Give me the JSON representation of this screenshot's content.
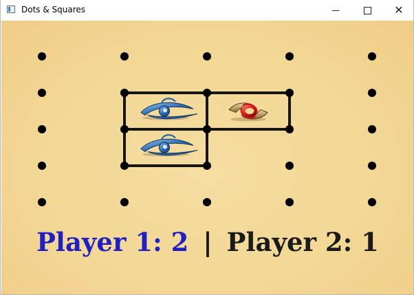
{
  "window": {
    "title": "Dots & Squares",
    "controls": [
      "minimize",
      "maximize",
      "close"
    ]
  },
  "board": {
    "rows": 5,
    "cols": 5,
    "horizontal_lines": [
      [
        1,
        1
      ],
      [
        1,
        2
      ],
      [
        2,
        1
      ],
      [
        2,
        2
      ],
      [
        3,
        1
      ]
    ],
    "vertical_lines": [
      [
        1,
        1
      ],
      [
        1,
        2
      ],
      [
        1,
        3
      ],
      [
        2,
        1
      ],
      [
        2,
        2
      ]
    ],
    "claimed_boxes": [
      {
        "row": 1,
        "col": 1,
        "owner": 1,
        "icon": "blue-eye-icon"
      },
      {
        "row": 1,
        "col": 2,
        "owner": 2,
        "icon": "red-swirl-icon"
      },
      {
        "row": 2,
        "col": 1,
        "owner": 1,
        "icon": "blue-eye-icon"
      }
    ]
  },
  "score": {
    "player1_label": "Player 1: 2",
    "separator": "|",
    "player2_label": "Player 2: 1",
    "player1_color": "#1f1fc6",
    "player2_color": "#1a1a1a"
  },
  "colors": {
    "board_bg": "#f3d896",
    "dot": "#000000",
    "line": "#151515"
  }
}
